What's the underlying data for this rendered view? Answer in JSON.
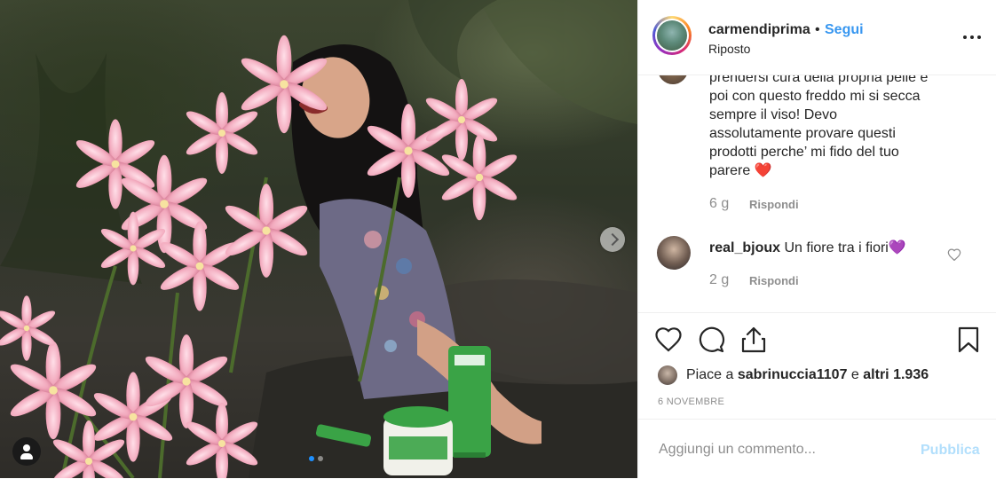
{
  "post": {
    "author": "carmendiprima",
    "bullet": "•",
    "follow_label": "Segui",
    "location": "Riposto",
    "more_label": "More options"
  },
  "comments": [
    {
      "text": "prendersi cura della propria pelle e poi con questo freddo mi si secca sempre il viso! Devo assolutamente provare questi prodotti perche’ mi fido del tuo parere",
      "emoji": "❤️",
      "time": "6 g",
      "reply_label": "Rispondi"
    },
    {
      "username": "real_bjoux",
      "text": "Un fiore tra i fiori",
      "emoji": "💜",
      "time": "2 g",
      "reply_label": "Rispondi"
    }
  ],
  "likes": {
    "prefix": "Piace a",
    "user": "sabrinuccia1107",
    "conjunction": "e",
    "others": "altri 1.936"
  },
  "date": "6 NOVEMBRE",
  "add_comment": {
    "placeholder": "Aggiungi un commento...",
    "publish_label": "Pubblica"
  },
  "carousel": {
    "total": 2,
    "current": 1
  },
  "colors": {
    "link_blue": "#3897f0",
    "publish_disabled": "#b2dffc",
    "heart_red": "#e0142c",
    "heart_purple": "#8e44ad",
    "text_gray": "#8e8e8e"
  },
  "icons": [
    "heart-icon",
    "comment-icon",
    "share-icon",
    "bookmark-icon",
    "chevron-right-icon",
    "user-tag-icon",
    "more-icon"
  ]
}
